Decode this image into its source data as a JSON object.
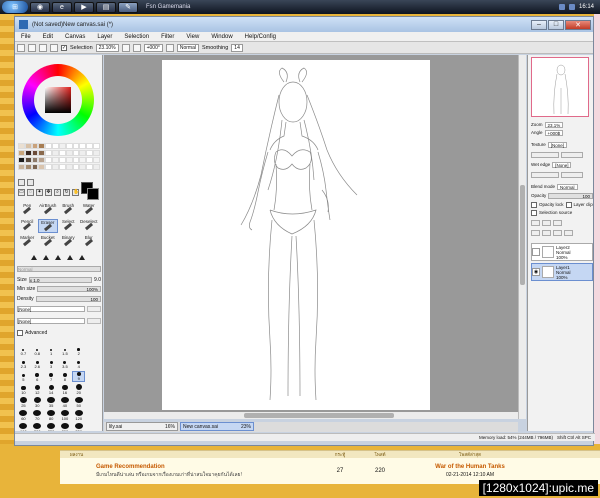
{
  "taskbar": {
    "tabs": [
      "Fsn Gamemania"
    ],
    "clock": "16:14"
  },
  "window": {
    "title": "(Not saved)New canvas.sai (*)",
    "app_logo": "PaintTool SAI"
  },
  "menu": [
    "File",
    "Edit",
    "Canvas",
    "Layer",
    "Selection",
    "Filter",
    "View",
    "Window",
    "Help/Config"
  ],
  "toolbar": {
    "selection_label": "Selection",
    "zoom": "23.10%",
    "rotation": "+000°",
    "blend": "Normal",
    "smoothing_label": "Smoothing",
    "smoothing_value": "14"
  },
  "tools": [
    {
      "label": "Pen"
    },
    {
      "label": "AirBrush"
    },
    {
      "label": "Brush"
    },
    {
      "label": "Water"
    },
    {
      "label": "Pencil"
    },
    {
      "label": "Eraser"
    },
    {
      "label": "Select"
    },
    {
      "label": "Deselect"
    },
    {
      "label": "Marker"
    },
    {
      "label": "Bucket"
    },
    {
      "label": "Binary"
    },
    {
      "label": "Blur"
    }
  ],
  "brush": {
    "mode": "Normal",
    "size_label": "Size",
    "size_mult": "x 1.0",
    "size_value": "9.0",
    "minsize_label": "Min size",
    "minsize_value": "100%",
    "density_label": "Density",
    "density_value": "100",
    "texture1": "[None]",
    "texture2": "[None]",
    "advanced_label": "Advanced",
    "sizes": [
      "0.7",
      "0.8",
      "1",
      "1.5",
      "2",
      "",
      "2.3",
      "2.6",
      "3",
      "3.5",
      "4",
      "",
      "5",
      "6",
      "7",
      "8",
      "9",
      "",
      "10",
      "12",
      "14",
      "16",
      "20",
      "",
      "25",
      "30",
      "35",
      "40",
      "50",
      "",
      "60",
      "70",
      "80",
      "100",
      "120",
      "",
      "160",
      "200",
      "250",
      "300",
      "350",
      ""
    ]
  },
  "navigator": {
    "zoom_label": "Zoom",
    "zoom_value": "23.1%",
    "angle_label": "Angle",
    "angle_value": "+000$"
  },
  "layers_panel": {
    "texture_label": "Texture",
    "texture_value": "[None]",
    "wetedge_label": "Wet edge",
    "wetedge_value": "[None]",
    "blend_label": "Blend mode",
    "blend_value": "Normal",
    "opacity_label": "Opacity",
    "opacity_value": "100",
    "protect_label": "Opacity lock",
    "clip_label": "Layer clip",
    "selsource_label": "Selection source",
    "layers": [
      {
        "name": "Layer2",
        "mode": "Normal",
        "opacity": "100%"
      },
      {
        "name": "Layer1",
        "mode": "Normal",
        "opacity": "100%"
      }
    ]
  },
  "files": [
    {
      "name": "lily.sai",
      "zoom": "16%"
    },
    {
      "name": "New canvas.sai",
      "zoom": "23%"
    }
  ],
  "status": {
    "memory": "Memory load: 54% (244MB / 796MB)",
    "keys": "Shift Ctrl Alt SPC"
  },
  "web": {
    "headers": [
      "ผลงาน",
      "กระทู้",
      "โพสต์",
      "โพสต์ล่าสุด"
    ],
    "forum_title": "Game Recommendation",
    "forum_desc": "มีเกมไหนดีน่าเล่น หรือเกมจากเรื่องเกมเก่าที่น่าสนใจมาคุยกันได้เลย!",
    "threads": "27",
    "posts": "220",
    "last_post_title": "War of the Human Tanks",
    "last_post_date": "02-21-2014 12:10 AM"
  },
  "watermark": "[1280x1024]:upic.me"
}
